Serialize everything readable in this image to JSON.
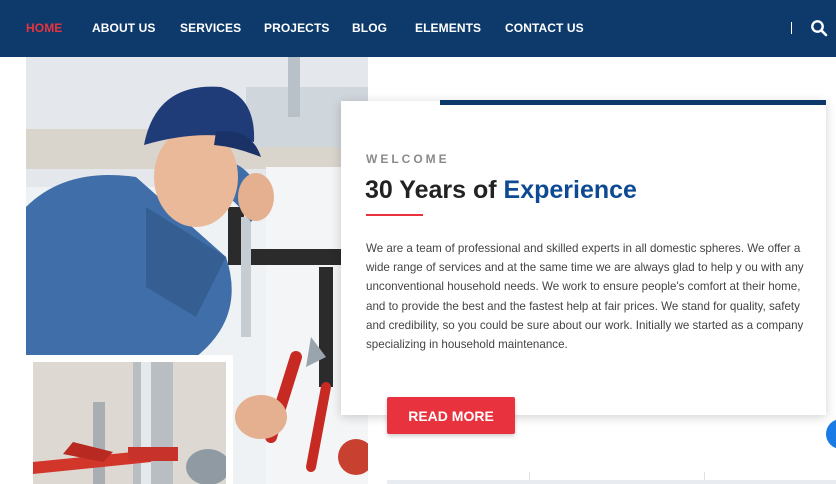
{
  "nav": {
    "items": [
      {
        "label": "HOME",
        "active": true
      },
      {
        "label": "ABOUT US",
        "active": false
      },
      {
        "label": "SERVICES",
        "active": false
      },
      {
        "label": "PROJECTS",
        "active": false
      },
      {
        "label": "BLOG",
        "active": false
      },
      {
        "label": "ELEMENTS",
        "active": false
      },
      {
        "label": "CONTACT US",
        "active": false
      }
    ],
    "search_icon": "search-icon"
  },
  "colors": {
    "nav_bg": "#0d3a6b",
    "accent_red": "#e8333f",
    "accent_blue": "#0e4a92",
    "text_dark": "#222222",
    "text_body": "#444444",
    "eyebrow_gray": "#8a8a8a"
  },
  "about": {
    "eyebrow": "WELCOME",
    "heading_prefix": "30 Years of",
    "heading_accent": "Experience",
    "body": "We are a team of professional and skilled experts in all domestic spheres. We offer a wide range of services and at the same time we are always glad to help y ou with any unconventional household needs. We work to ensure people's comfort at their home, and to provide the best and the fastest help at fair prices. We stand for quality, safety and credibility, so you could be sure about our work. Initially we started as a company specializing in household maintenance.",
    "button_label": "READ MORE"
  }
}
